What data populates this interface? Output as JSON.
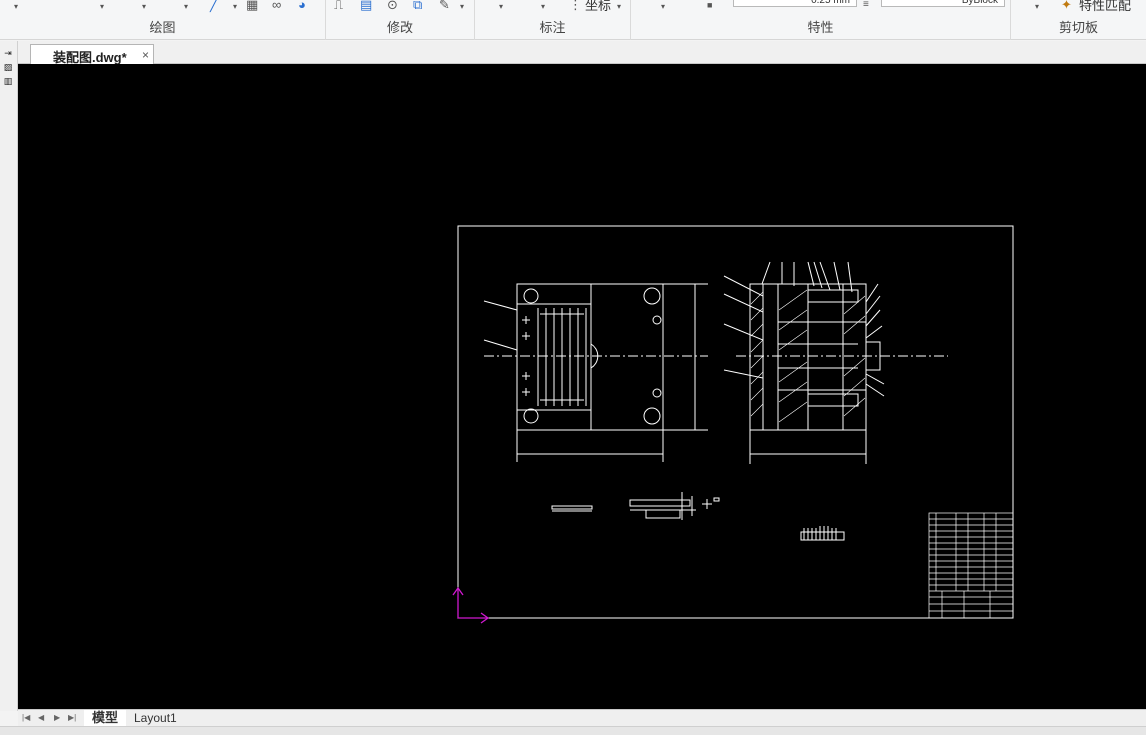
{
  "ribbon": {
    "panels": [
      {
        "label": "绘图"
      },
      {
        "label": "修改"
      },
      {
        "label": "标注"
      },
      {
        "label": "特性"
      },
      {
        "label": "剪切板"
      }
    ],
    "dim_coord_label": "坐标",
    "lineweight_value": "0.25 mm",
    "linetype_value": "ByBlock",
    "match_props_label": "特性匹配"
  },
  "tabs": {
    "document_tab": "装配图.dwg*",
    "close_glyph": "×"
  },
  "layout_tabs": [
    {
      "label": "模型",
      "active": true
    },
    {
      "label": "Layout1",
      "active": false
    }
  ],
  "colors": {
    "canvas_bg": "#000000",
    "drawing_lines": "#ffffff",
    "ucs_icon": "#d018d0",
    "ribbon_bg": "#f5f6f7"
  },
  "icons": [
    "line-icon",
    "hatch-icon",
    "circle-icon",
    "region-icon",
    "stretch-icon",
    "scale-icon",
    "offset-icon",
    "copy-icon",
    "edit-icon",
    "dim-coord-icon",
    "color-swatch-icon",
    "linetype-icon",
    "match-props-icon",
    "ucs-icon"
  ]
}
